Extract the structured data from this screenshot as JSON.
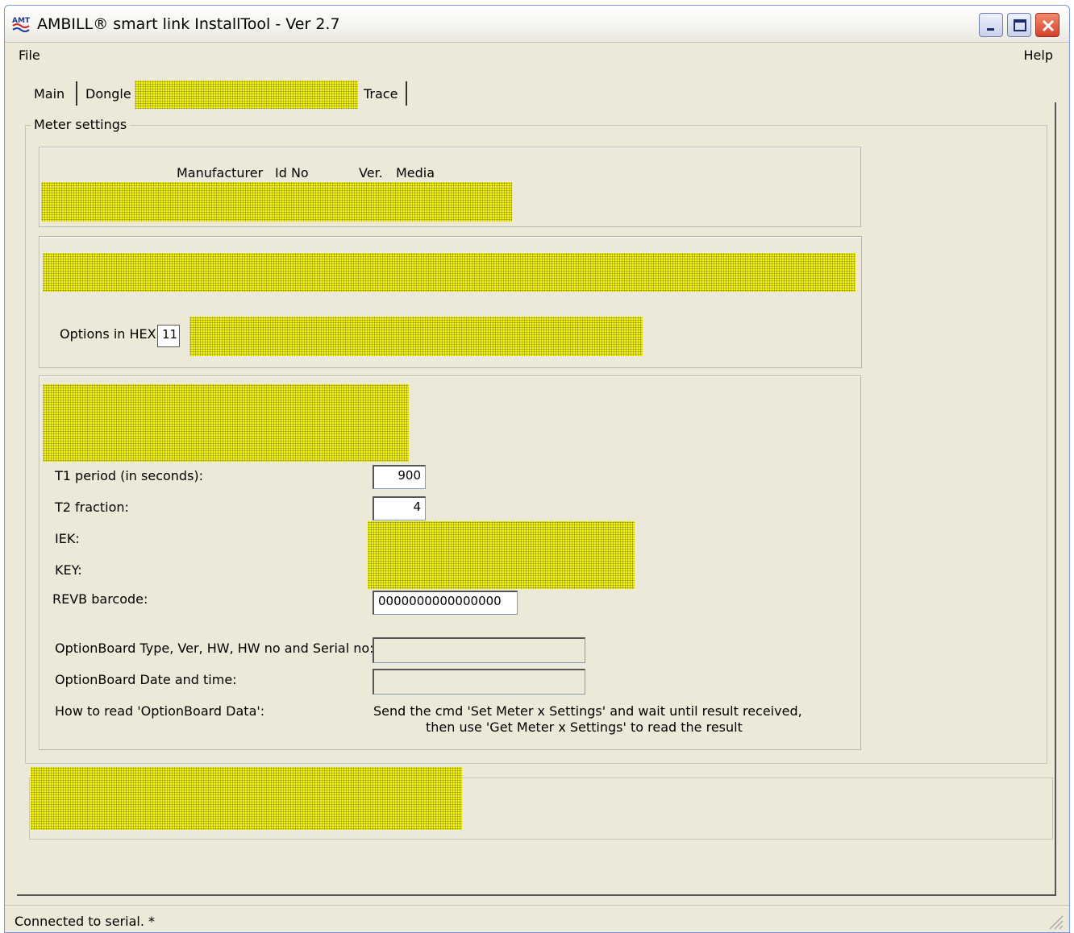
{
  "window": {
    "title": "AMBILL® smart link InstallTool - Ver 2.7"
  },
  "menu": {
    "file": "File",
    "help": "Help"
  },
  "tabs": {
    "main": "Main",
    "dongle": "Dongle",
    "trace": "Trace"
  },
  "meter_settings": {
    "group_title": "Meter settings",
    "header": {
      "manufacturer": "Manufacturer",
      "id_no": "Id No",
      "ver": "Ver.",
      "media": "Media"
    },
    "options_hex_label": "Options in HEX",
    "options_hex_value": "11",
    "t1_label": "T1 period (in seconds):",
    "t1_value": "900",
    "t2_label": "T2 fraction:",
    "t2_value": "4",
    "iek_label": "IEK:",
    "key_label": "KEY:",
    "revb_label": "REVB barcode:",
    "revb_value": "0000000000000000",
    "optionboard_type_label": "OptionBoard Type, Ver, HW, HW no and Serial no:",
    "optionboard_type_value": "",
    "optionboard_date_label": "OptionBoard Date and time:",
    "optionboard_date_value": "",
    "howto_label": "How to read 'OptionBoard Data':",
    "howto_line1": "Send the cmd 'Set Meter x Settings' and wait until result received,",
    "howto_line2": "then use 'Get Meter x Settings' to read the result"
  },
  "status": {
    "text": "Connected to serial.  *"
  },
  "colors": {
    "window_bg": "#ece9d8",
    "redaction": "#f5f500",
    "close_button": "#d6402b"
  },
  "icons": {
    "app": "amt-logo-icon",
    "minimize": "minimize-icon",
    "maximize": "maximize-icon",
    "close": "close-icon",
    "grip": "resize-grip-icon"
  }
}
